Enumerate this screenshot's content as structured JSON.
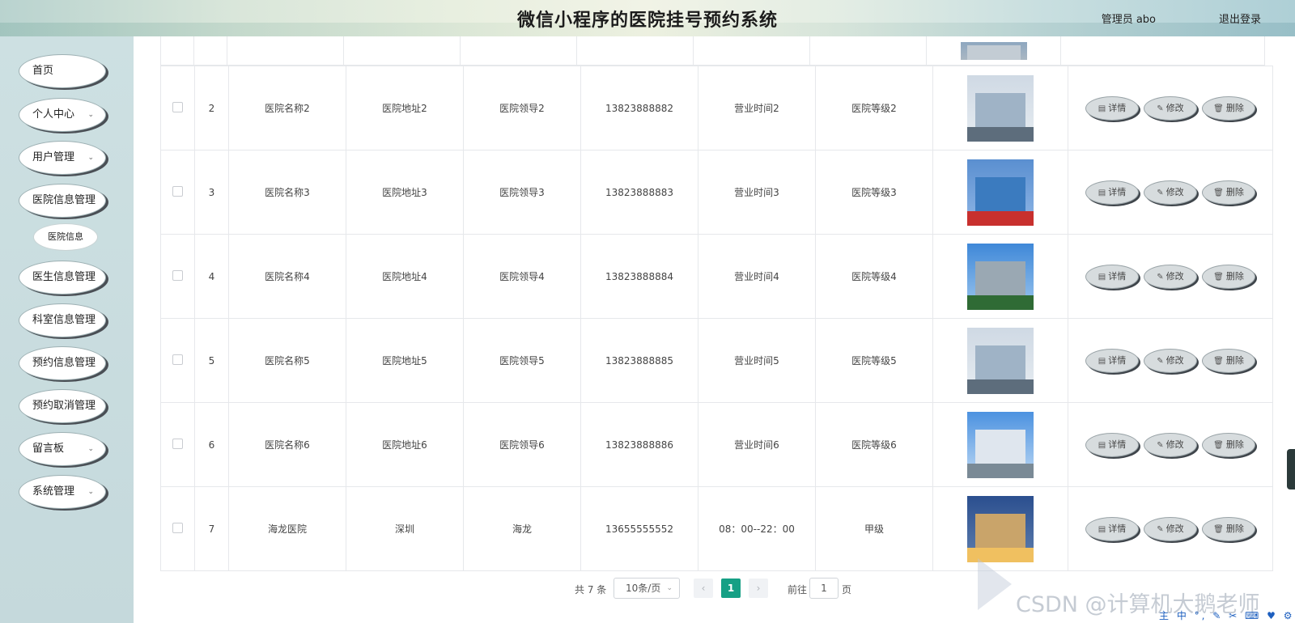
{
  "header": {
    "title": "微信小程序的医院挂号预约系统",
    "admin_label": "管理员 abo",
    "logout_label": "退出登录"
  },
  "sidebar": {
    "items": [
      {
        "label": "首页",
        "has_arrow": false
      },
      {
        "label": "个人中心",
        "has_arrow": true
      },
      {
        "label": "用户管理",
        "has_arrow": true
      },
      {
        "label": "医院信息管理",
        "has_arrow": false
      },
      {
        "label": "医生信息管理",
        "has_arrow": false
      },
      {
        "label": "科室信息管理",
        "has_arrow": false
      },
      {
        "label": "预约信息管理",
        "has_arrow": false
      },
      {
        "label": "预约取消管理",
        "has_arrow": false
      },
      {
        "label": "留言板",
        "has_arrow": true
      },
      {
        "label": "系统管理",
        "has_arrow": true
      }
    ],
    "sub_item": "医院信息",
    "arrow_glyph": "⌄"
  },
  "actions": {
    "detail": "详情",
    "edit": "修改",
    "delete": "删除"
  },
  "rows": [
    {
      "index": "2",
      "name": "医院名称2",
      "address": "医院地址2",
      "leader": "医院领导2",
      "phone": "13823888882",
      "hours": "营业时间2",
      "level": "医院等级2"
    },
    {
      "index": "3",
      "name": "医院名称3",
      "address": "医院地址3",
      "leader": "医院领导3",
      "phone": "13823888883",
      "hours": "营业时间3",
      "level": "医院等级3"
    },
    {
      "index": "4",
      "name": "医院名称4",
      "address": "医院地址4",
      "leader": "医院领导4",
      "phone": "13823888884",
      "hours": "营业时间4",
      "level": "医院等级4"
    },
    {
      "index": "5",
      "name": "医院名称5",
      "address": "医院地址5",
      "leader": "医院领导5",
      "phone": "13823888885",
      "hours": "营业时间5",
      "level": "医院等级5"
    },
    {
      "index": "6",
      "name": "医院名称6",
      "address": "医院地址6",
      "leader": "医院领导6",
      "phone": "13823888886",
      "hours": "营业时间6",
      "level": "医院等级6"
    },
    {
      "index": "7",
      "name": "海龙医院",
      "address": "深圳",
      "leader": "海龙",
      "phone": "13655555552",
      "hours": "08：00--22：00",
      "level": "甲级"
    }
  ],
  "pagination": {
    "total": "共 7 条",
    "page_size": "10条/页",
    "current": "1",
    "goto_label": "前往",
    "goto_value": "1",
    "page_unit": "页"
  },
  "watermark": "CSDN @计算机大鹅老师",
  "tray_icons": "主 中 °, ✎ ✂ ⌨ ♥ ⚙",
  "colors": {
    "accent": "#16a085",
    "sidebar_bg": "#cde0e2"
  }
}
